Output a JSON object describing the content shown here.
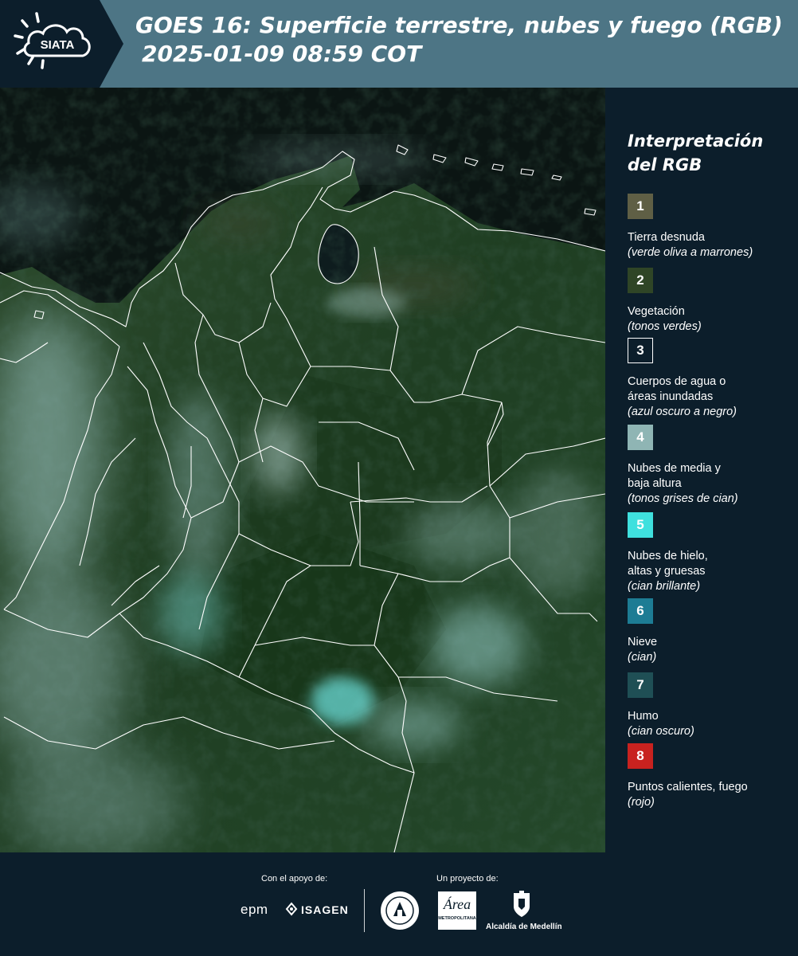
{
  "header": {
    "logo_text": "SIATA",
    "title_line1": "GOES 16: Superficie terrestre, nubes y fuego (RGB)",
    "title_line2": "2025-01-09 08:59 COT"
  },
  "legend": {
    "title_line1": "Interpretación",
    "title_line2": "del RGB",
    "items": [
      {
        "number": "1",
        "label_lines": [
          "Tierra desnuda"
        ],
        "note": "(verde oliva a marrones)",
        "color": "#5f5f45",
        "icon": "bare-soil-swatch"
      },
      {
        "number": "2",
        "label_lines": [
          "Vegetación"
        ],
        "note": "(tonos verdes)",
        "color": "#2f4526",
        "icon": "vegetation-swatch"
      },
      {
        "number": "3",
        "label_lines": [
          "Cuerpos de agua o",
          "áreas inundadas"
        ],
        "note": "(azul oscuro a negro)",
        "color": "#0c1e2b",
        "icon": "water-swatch"
      },
      {
        "number": "4",
        "label_lines": [
          "Nubes de media y",
          "baja altura"
        ],
        "note": "(tonos grises de cian)",
        "color": "#8fb5b4",
        "icon": "mid-low-cloud-swatch"
      },
      {
        "number": "5",
        "label_lines": [
          "Nubes de hielo,",
          "altas y gruesas"
        ],
        "note": "(cian brillante)",
        "color": "#3fe0de",
        "icon": "ice-cloud-swatch"
      },
      {
        "number": "6",
        "label_lines": [
          "Nieve"
        ],
        "note": "(cian)",
        "color": "#1d7c94",
        "icon": "snow-swatch"
      },
      {
        "number": "7",
        "label_lines": [
          "Humo"
        ],
        "note": "(cian oscuro)",
        "color": "#1f4f55",
        "icon": "smoke-swatch"
      },
      {
        "number": "8",
        "label_lines": [
          "Puntos calientes, fuego"
        ],
        "note": "(rojo)",
        "color": "#c8221f",
        "icon": "fire-swatch"
      }
    ]
  },
  "footer": {
    "support_caption": "Con el apoyo de:",
    "project_caption": "Un proyecto de:",
    "sponsors": [
      "epm",
      "ISAGEN"
    ],
    "area_logo_text": "Área",
    "area_logo_sub": "METROPOLITANA",
    "medellin_label": "Alcaldía de Medellín"
  },
  "colors": {
    "header_bg": "#4d7585",
    "panel_bg": "#0c1e2b",
    "border_lines": "#ffffff"
  }
}
